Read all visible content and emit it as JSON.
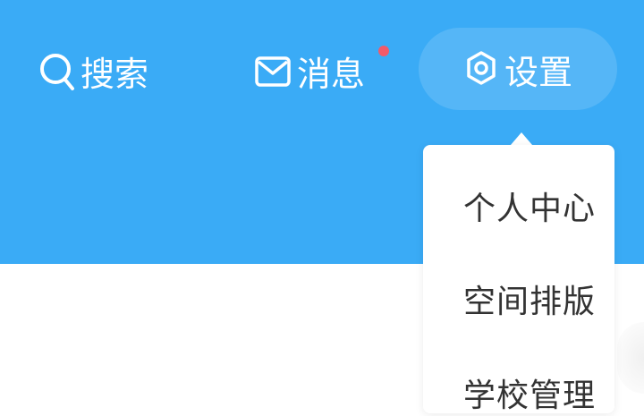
{
  "header": {
    "bg_color": "#3aabf6",
    "search": {
      "label": "搜索",
      "icon": "search-icon"
    },
    "messages": {
      "label": "消息",
      "icon": "mail-icon",
      "badge_color": "#f25a6a"
    },
    "settings": {
      "label": "设置",
      "icon": "gear-icon"
    }
  },
  "settings_menu": {
    "items": [
      {
        "label": "个人中心"
      },
      {
        "label": "空间排版"
      },
      {
        "label": "学校管理"
      }
    ]
  }
}
